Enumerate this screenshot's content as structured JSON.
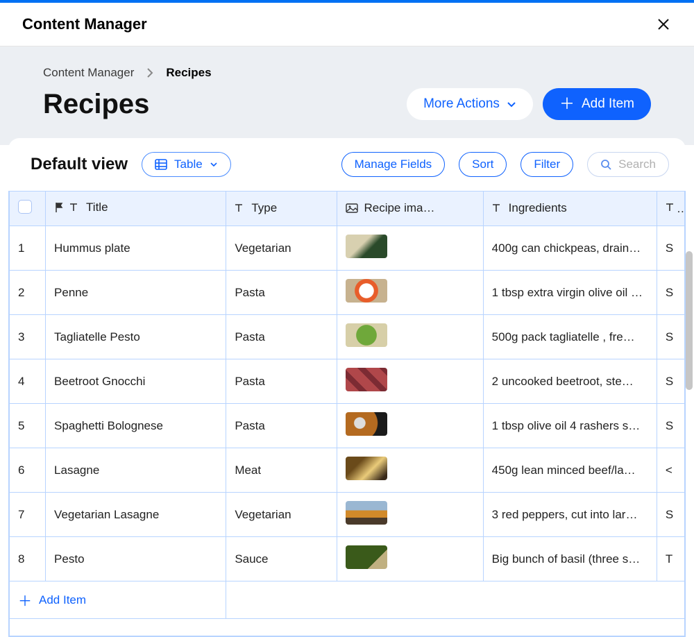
{
  "header": {
    "title": "Content Manager"
  },
  "breadcrumbs": {
    "root": "Content Manager",
    "current": "Recipes"
  },
  "page": {
    "title": "Recipes"
  },
  "actions": {
    "more": "More Actions",
    "add": "Add Item"
  },
  "viewbar": {
    "view_name": "Default view",
    "view_mode": "Table",
    "manage_fields": "Manage Fields",
    "sort": "Sort",
    "filter": "Filter",
    "search_placeholder": "Search"
  },
  "columns": {
    "title": "Title",
    "type": "Type",
    "recipe_image": "Recipe ima…",
    "ingredients": "Ingredients"
  },
  "rows": [
    {
      "n": "1",
      "title": "Hummus plate",
      "type": "Vegetarian",
      "ing": "400g can chickpeas, drain…",
      "tail": "S"
    },
    {
      "n": "2",
      "title": "Penne",
      "type": "Pasta",
      "ing": "1 tbsp extra virgin olive oil …",
      "tail": "S"
    },
    {
      "n": "3",
      "title": "Tagliatelle Pesto",
      "type": "Pasta",
      "ing": "500g pack tagliatelle , fre…",
      "tail": "S"
    },
    {
      "n": "4",
      "title": "Beetroot Gnocchi",
      "type": "Pasta",
      "ing": "2 uncooked beetroot, ste…",
      "tail": "S"
    },
    {
      "n": "5",
      "title": "Spaghetti Bolognese",
      "type": "Pasta",
      "ing": "1 tbsp olive oil 4 rashers s…",
      "tail": "S"
    },
    {
      "n": "6",
      "title": "Lasagne",
      "type": "Meat",
      "ing": "450g lean minced beef/la…",
      "tail": "<"
    },
    {
      "n": "7",
      "title": "Vegetarian Lasagne",
      "type": "Vegetarian",
      "ing": "3 red peppers, cut into lar…",
      "tail": "S"
    },
    {
      "n": "8",
      "title": "Pesto",
      "type": "Sauce",
      "ing": "Big bunch of basil (three s…",
      "tail": "T"
    }
  ],
  "footer": {
    "add_item": "Add Item"
  }
}
